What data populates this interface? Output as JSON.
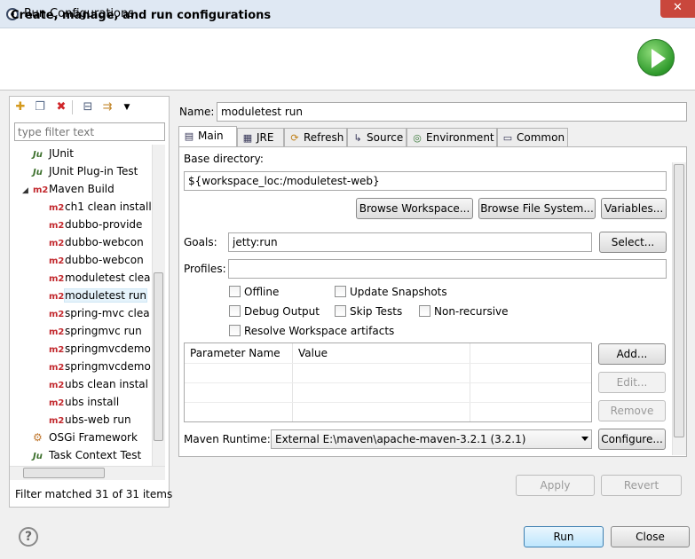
{
  "window": {
    "title": "Run Configurations",
    "close_glyph": "✕"
  },
  "header": {
    "title": "Create, manage, and run configurations"
  },
  "left": {
    "filter_placeholder": "type filter text",
    "tree": [
      {
        "label": "JUnit",
        "icon": "ju"
      },
      {
        "label": "JUnit Plug-in Test",
        "icon": "ju"
      },
      {
        "label": "Maven Build",
        "icon": "m2",
        "expanded": true
      },
      {
        "label": "ch1 clean install",
        "icon": "m2"
      },
      {
        "label": "dubbo-provide",
        "icon": "m2"
      },
      {
        "label": "dubbo-webcon",
        "icon": "m2"
      },
      {
        "label": "dubbo-webcon",
        "icon": "m2"
      },
      {
        "label": "moduletest clea",
        "icon": "m2"
      },
      {
        "label": "moduletest run",
        "icon": "m2",
        "selected": true
      },
      {
        "label": "spring-mvc clea",
        "icon": "m2"
      },
      {
        "label": "springmvc run",
        "icon": "m2"
      },
      {
        "label": "springmvcdemo",
        "icon": "m2"
      },
      {
        "label": "springmvcdemo",
        "icon": "m2"
      },
      {
        "label": "ubs clean instal",
        "icon": "m2"
      },
      {
        "label": "ubs install",
        "icon": "m2"
      },
      {
        "label": "ubs-web run",
        "icon": "m2"
      },
      {
        "label": "OSGi Framework",
        "icon": "osgi"
      },
      {
        "label": "Task Context Test",
        "icon": "ju"
      }
    ],
    "status": "Filter matched 31 of 31 items",
    "m2_text": "m2",
    "ju_text": "Ju"
  },
  "config": {
    "name_label": "Name:",
    "name_value": "moduletest run",
    "tabs": [
      "Main",
      "JRE",
      "Refresh",
      "Source",
      "Environment",
      "Common"
    ],
    "base_label": "Base directory:",
    "base_value": "${workspace_loc:/moduletest-web}",
    "btn_workspace": "Browse Workspace...",
    "btn_filesystem": "Browse File System...",
    "btn_variables": "Variables...",
    "goals_label": "Goals:",
    "goals_value": "jetty:run",
    "btn_select": "Select...",
    "profiles_label": "Profiles:",
    "profiles_value": "",
    "chk_offline": "Offline",
    "chk_update": "Update Snapshots",
    "chk_debug": "Debug Output",
    "chk_skip": "Skip Tests",
    "chk_nonrec": "Non-recursive",
    "chk_resolve": "Resolve Workspace artifacts",
    "param_col1": "Parameter Name",
    "param_col2": "Value",
    "btn_add": "Add...",
    "btn_edit": "Edit...",
    "btn_remove": "Remove",
    "runtime_label": "Maven Runtime:",
    "runtime_value": "External E:\\maven\\apache-maven-3.2.1 (3.2.1)",
    "btn_configure": "Configure..."
  },
  "footer": {
    "apply": "Apply",
    "revert": "Revert",
    "run": "Run",
    "close": "Close",
    "help_glyph": "?"
  }
}
